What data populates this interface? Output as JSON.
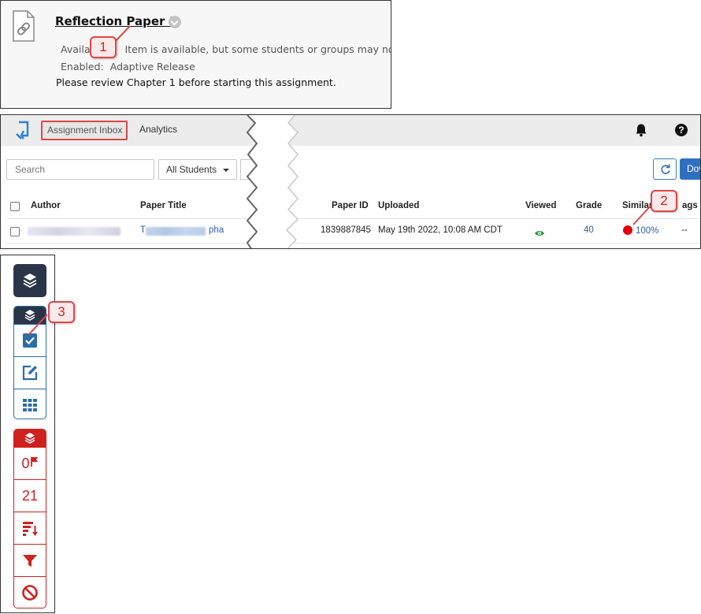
{
  "panel1": {
    "title": "Reflection Paper 1",
    "availability_prefix": "Availa",
    "availability_suffix": "Item is available, but some students or groups may not ha",
    "enabled_label": "Enabled:",
    "enabled_value": "Adaptive Release",
    "description": "Please review Chapter 1 before starting this assignment.",
    "icon": "document-link-icon",
    "callout": "1"
  },
  "panel2": {
    "tabs": {
      "inbox": "Assignment Inbox",
      "analytics": "Analytics"
    },
    "search_placeholder": "Search",
    "filter_value": "All Students",
    "download_label": "Dov",
    "columns": {
      "author": "Author",
      "paper_title": "Paper Title",
      "paper_id": "Paper ID",
      "uploaded": "Uploaded",
      "viewed": "Viewed",
      "grade": "Grade",
      "similarity": "Similar",
      "flags": "ags"
    },
    "row": {
      "title_prefix": "T",
      "title_suffix": "pha",
      "paper_id": "1839887845",
      "uploaded": "May 19th 2022, 10:08 AM CDT",
      "grade": "40",
      "similarity": "100%",
      "flags": "--"
    },
    "callout": "2",
    "colors": {
      "accent": "#2f6fc2",
      "similarity_dot": "#e0000f",
      "viewed_eye": "#2e9e4a"
    }
  },
  "panel3": {
    "callout": "3",
    "red_group": {
      "flag_count": "0",
      "count": "21"
    },
    "colors": {
      "dark": "#2b3548",
      "blue": "#2b6ea5",
      "red": "#d02020"
    }
  }
}
